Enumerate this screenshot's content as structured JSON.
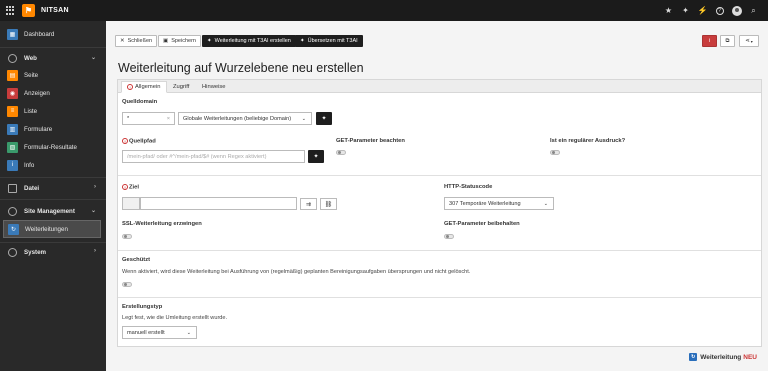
{
  "topbar": {
    "site_name": "NITSAN",
    "icons": [
      "star-icon",
      "sparkle-icon",
      "bolt-icon",
      "help-icon",
      "user-icon",
      "search-icon"
    ],
    "glyphs": {
      "star": "★",
      "sparkle": "✦",
      "bolt": "⚡",
      "help": "?",
      "search": "⌕"
    }
  },
  "sidebar": {
    "dashboard": "Dashboard",
    "web": "Web",
    "page": "Seite",
    "view": "Anzeigen",
    "list": "Liste",
    "forms": "Formulare",
    "form_results": "Formular-Resultate",
    "info": "Info",
    "file": "Datei",
    "site_management": "Site Management",
    "redirects": "Weiterleitungen",
    "system": "System",
    "colors": {
      "page": "#ff8700",
      "view": "#c83c3c",
      "list": "#ff8700",
      "forms": "#3a7ab8",
      "form_results": "#3a9a6b",
      "info": "#3a7ab8",
      "redirects": "#3a7ab8"
    }
  },
  "toolbar": {
    "close": "Schließen",
    "save": "Speichern",
    "t3ai_redirect": "Weiterleitung mit T3AI erstellen",
    "t3ai_translate": "Übersetzen mit T3AI"
  },
  "page": {
    "title": "Weiterleitung auf Wurzelebene neu erstellen"
  },
  "tabs": [
    {
      "label": "Allgemein",
      "active": true
    },
    {
      "label": "Zugriff",
      "active": false
    },
    {
      "label": "Hinweise",
      "active": false
    }
  ],
  "form": {
    "source_domain_label": "Quelldomain",
    "source_domain_value": "*",
    "source_domain_clear": "×",
    "source_domain_select": "Globale Weiterleitungen (beliebige Domain)",
    "source_path_label": "Quellpfad",
    "source_path_placeholder": "/mein-pfad/ oder #^/mein-pfad/$# (wenn Regex aktiviert)",
    "get_params_label": "GET-Parameter beachten",
    "regex_label": "Ist ein regulärer Ausdruck?",
    "target_label": "Ziel",
    "status_label": "HTTP-Statuscode",
    "status_value": "307 Temporäre Weiterleitung",
    "force_ssl_label": "SSL-Weiterleitung erzwingen",
    "keep_get_label": "GET-Parameter beibehalten",
    "protected_label": "Geschützt",
    "protected_desc": "Wenn aktiviert, wird diese Weiterleitung bei Ausführung von (regelmäßig) geplanten Bereinigungsaufgaben übersprungen und nicht gelöscht.",
    "creation_type_label": "Erstellungstyp",
    "creation_type_desc": "Legt fest, wie die Umleitung erstellt wurde.",
    "creation_type_value": "manuell erstellt"
  },
  "footer": {
    "label": "Weiterleitung",
    "badge": "NEU"
  }
}
